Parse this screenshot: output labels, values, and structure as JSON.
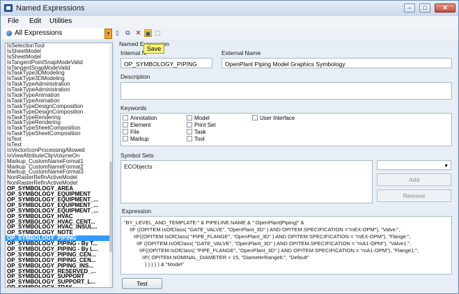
{
  "window": {
    "title": "Named Expressions",
    "controls": {
      "minimize": "–",
      "restore": "□",
      "close": "✕"
    }
  },
  "menu": [
    "File",
    "Edit",
    "Utilities"
  ],
  "toolbar": {
    "filter_value": "All Expressions",
    "dropdown_glyph": "▾",
    "tools": [
      {
        "icon": "new-icon",
        "glyph": "▯"
      },
      {
        "icon": "copy-icon",
        "glyph": "⧉"
      },
      {
        "icon": "delete-icon",
        "glyph": "✕"
      },
      {
        "icon": "save-icon",
        "glyph": "▣"
      },
      {
        "icon": "export-icon",
        "glyph": "⬚"
      }
    ],
    "tooltip": "Save"
  },
  "expressions": [
    "IsSelectionTool",
    "IsSheetModel",
    "IsSheetModel",
    "IsTangentPointSnapModeValid",
    "IsTangentSnapModeValid",
    "IsTaskType3DModeling",
    "IsTaskType3DModeling",
    "IsTaskTypeAdministration",
    "IsTaskTypeAdministration",
    "IsTaskTypeAnimation",
    "IsTaskTypeAnimation",
    "IsTaskTypeDesignComposition",
    "IsTaskTypeDesignComposition",
    "IsTaskTypeRendering",
    "IsTaskTypeRendering",
    "IsTaskTypeSheetComposition",
    "IsTaskTypeSheetComposition",
    "IsText",
    "IsText",
    "IsVectorIconProcessingAllowed",
    "IsViewAttributeClipVolumeOn",
    "Markup_CustomNameFormat1",
    "Markup_CustomNameFormat2",
    "Markup_CustomNameFormat3",
    "NonRasterRefInActiveModel",
    "NonRasterRefInActiveModel",
    "OP_SYMBOLOGY_AREA",
    "OP_SYMBOLOGY_EQUIPMENT",
    "OP_SYMBOLOGY_EQUIPMENT_...",
    "OP_SYMBOLOGY_EQUIPMENT_...",
    "OP_SYMBOLOGY_EQUIPMENT_...",
    "OP_SYMBOLOGY_HVAC",
    "OP_SYMBOLOGY_HVAC_CENT...",
    "OP_SYMBOLOGY_HVAC_INSUL...",
    "OP_SYMBOLOGY_NOTE",
    "OP_SYMBOLOGY_PIPING",
    "OP_SYMBOLOGY_PIPING - By T...",
    "OP_SYMBOLOGY_PIPING - By L...",
    "OP_SYMBOLOGY_PIPING_CEN...",
    "OP_SYMBOLOGY_PIPING_CEN...",
    "OP_SYMBOLOGY_PIPING_INS...",
    "OP_SYMBOLOGY_RESERVED_...",
    "OP_SYMBOLOGY_SUPPORT",
    "OP_SYMBOLOGY_SUPPORT_L...",
    "OP_SYMBOLOGY_TRAY",
    "OP_SYMBOLOGY_TRAY_CENT..."
  ],
  "selected_index": 35,
  "bold_from_index": 26,
  "details": {
    "section_title": "Named Expression",
    "internal_name_label": "Internal N",
    "internal_name": "OP_SYMBOLOGY_PIPING",
    "external_name_label": "External Name",
    "external_name": "OpenPlant Piping Model Graphics Symbology",
    "description_label": "Description",
    "description": "",
    "keywords_label": "Keywords",
    "keywords_col1": [
      "Annotation",
      "Element",
      "File",
      "Markup"
    ],
    "keywords_col2": [
      "Model",
      "Print Set",
      "Task",
      "Tool"
    ],
    "keywords_col3": [
      "User Interface"
    ],
    "symbol_sets_label": "Symbol Sets",
    "symbol_sets": [
      "ECObjects"
    ],
    "symbol_set_dropdown": "",
    "add_label": "Add",
    "remove_label": "Remove",
    "expression_label": "Expression",
    "expression_lines": [
      "\"BY_LEVEL_AND_TEMPLATE:\" & PIPELINE.NAME & \":OpenPlant|Piping|\" &",
      "IIF ((OPITEM.IsOfClass( \"GATE_VALVE\", \"OpenPlant_3D\" ) AND OPITEM.SPECIFICATION =\"mEX-OPM\"), \"Valve:\",",
      "IIF((OPITEM.IsOfClass( \"PIPE_FLANGE\", \"OpenPlant_3D\" ) AND OPITEM.SPECIFICATION = \"mEX-OPM\"), \"Flange:\",",
      "IIF ((OPITEM.IsOfClass( \"GATE_VALVE\", \"OpenPlant_3D\" ) AND OPITEM.SPECIFICATION = \"mA1-OPM\"), \"Valve1:\",",
      "IIF((OPITEM.IsOfClass( \"PIPE_FLANGE\", \"OpenPlant_3D\" ) AND OPITEM.SPECIFICATION = \"mA1-OPM\"), \"Flange1:\",",
      "IIF( OPITEM.NOMINAL_DIAMETER < 15, \"DiameterRange6:\", \"Default\"",
      ") ) ) ) ) & \"Model\""
    ],
    "test_label": "Test"
  }
}
